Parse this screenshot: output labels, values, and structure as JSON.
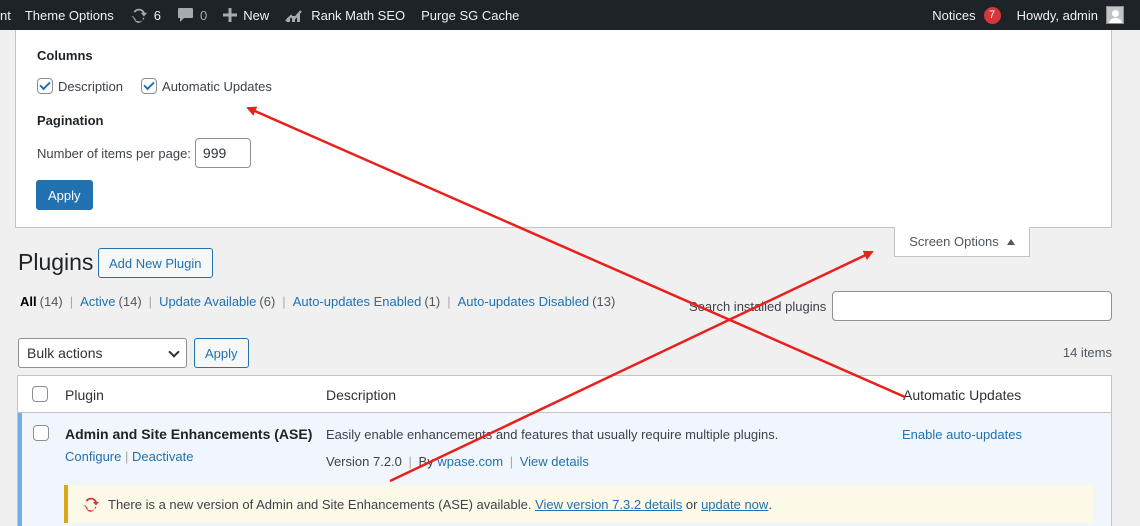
{
  "adminbar": {
    "left_partial": "nt",
    "theme_options": "Theme Options",
    "updates_count": "6",
    "comments_count": "0",
    "new_label": "New",
    "rank_math": "Rank Math SEO",
    "purge_cache": "Purge SG Cache",
    "notices_label": "Notices",
    "notices_count": "7",
    "howdy": "Howdy, admin"
  },
  "screen_options": {
    "columns_heading": "Columns",
    "columns": [
      {
        "label": "Description",
        "checked": true
      },
      {
        "label": "Automatic Updates",
        "checked": true
      }
    ],
    "pagination_heading": "Pagination",
    "per_page_label": "Number of items per page:",
    "per_page_value": "999",
    "apply_label": "Apply",
    "tab_label": "Screen Options"
  },
  "page": {
    "title": "Plugins",
    "add_new": "Add New Plugin",
    "filters": [
      {
        "label": "All",
        "count": "(14)",
        "current": true
      },
      {
        "label": "Active",
        "count": "(14)",
        "current": false
      },
      {
        "label": "Update Available",
        "count": "(6)",
        "current": false
      },
      {
        "label": "Auto-updates Enabled",
        "count": "(1)",
        "current": false
      },
      {
        "label": "Auto-updates Disabled",
        "count": "(13)",
        "current": false
      }
    ],
    "search_label": "Search installed plugins",
    "search_value": "",
    "bulk_actions": "Bulk actions",
    "bulk_apply": "Apply",
    "items_count": "14 items"
  },
  "table": {
    "headers": {
      "plugin": "Plugin",
      "description": "Description",
      "auto_updates": "Automatic Updates"
    },
    "row": {
      "name": "Admin and Site Enhancements (ASE)",
      "configure": "Configure",
      "deactivate": "Deactivate",
      "description": "Easily enable enhancements and features that usually require multiple plugins.",
      "version_text": "Version 7.2.0",
      "by_text": "By",
      "author": "wpase.com",
      "view_details": "View details",
      "auto_update_link": "Enable auto-updates"
    },
    "notice": {
      "text": "There is a new version of Admin and Site Enhancements (ASE) available.",
      "link1": "View version 7.3.2 details",
      "or": "or",
      "link2": "update now",
      "end": "."
    }
  },
  "colors": {
    "adminbar": "#1d2327",
    "accent": "#2271b1",
    "arrow": "#e8211d",
    "notice_border": "#dba617"
  }
}
